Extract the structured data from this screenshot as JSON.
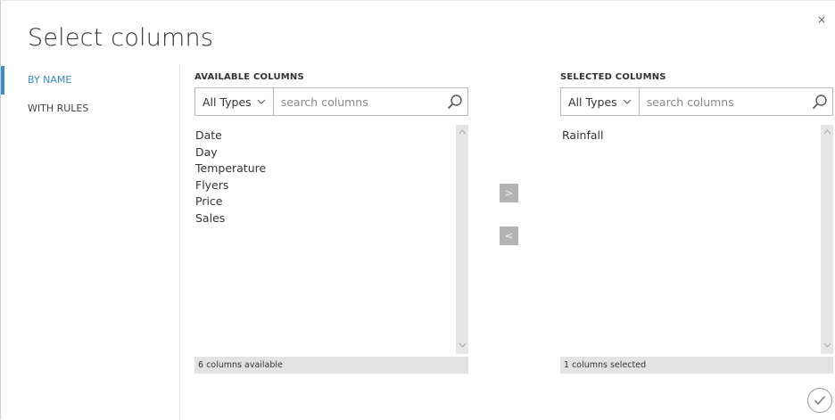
{
  "dialog": {
    "title": "Select columns",
    "close_label": "×"
  },
  "sidebar": {
    "items": [
      {
        "label": "BY NAME",
        "active": true
      },
      {
        "label": "WITH RULES",
        "active": false
      }
    ]
  },
  "available": {
    "label": "AVAILABLE COLUMNS",
    "type_filter": "All Types",
    "search_placeholder": "search columns",
    "items": [
      "Date",
      "Day",
      "Temperature",
      "Flyers",
      "Price",
      "Sales"
    ],
    "footer": "6 columns available"
  },
  "selected": {
    "label": "SELECTED COLUMNS",
    "type_filter": "All Types",
    "search_placeholder": "search columns",
    "items": [
      "Rainfall"
    ],
    "footer": "1 columns selected"
  },
  "actions": {
    "add_label": ">",
    "remove_label": "<"
  },
  "icons": {
    "search": "search-icon",
    "chevron": "chevron-down-icon",
    "ok": "checkmark-icon",
    "close": "close-icon"
  },
  "colors": {
    "accent": "#3a8bc8",
    "button_gray": "#b3b3b3",
    "scrollbar": "#e6e6e6",
    "footer_bg": "#e3e3e3"
  }
}
